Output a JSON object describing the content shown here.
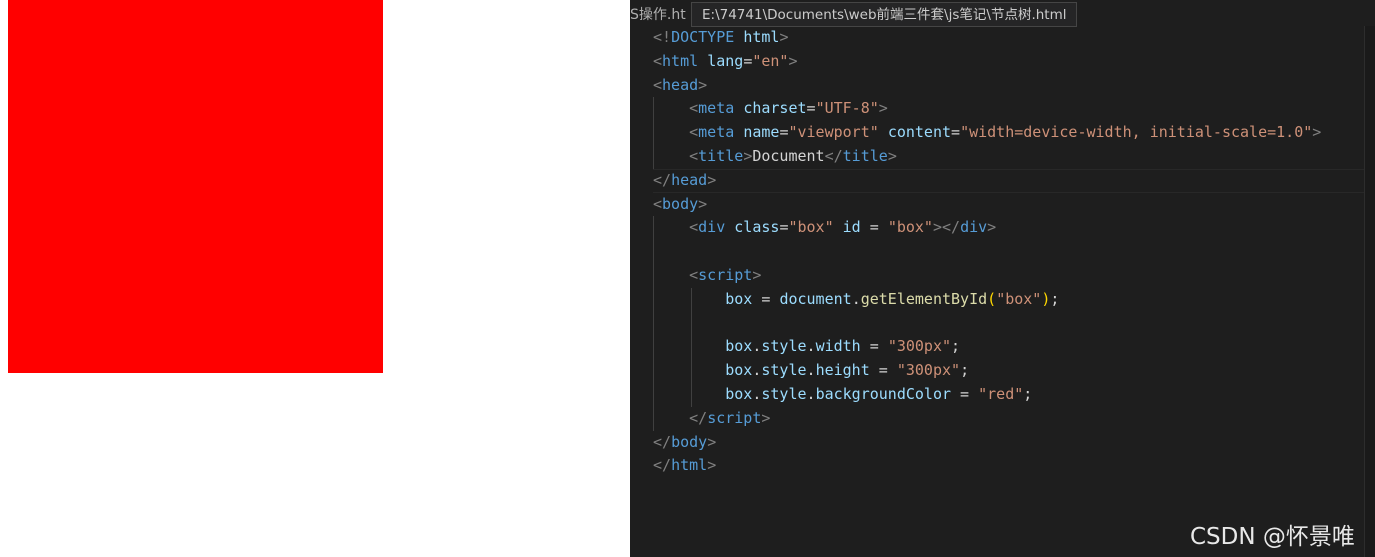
{
  "preview": {
    "box_color": "#ff0000"
  },
  "editor": {
    "tab_fragment": "S操作.ht",
    "tooltip_path": "E:\\74741\\Documents\\web前端三件套\\js笔记\\节点树.html",
    "lines": [
      [
        [
          "punc",
          "<!"
        ],
        [
          "tag",
          "DOCTYPE "
        ],
        [
          "attr",
          "html"
        ],
        [
          "punc",
          ">"
        ]
      ],
      [
        [
          "punc",
          "<"
        ],
        [
          "tag",
          "html "
        ],
        [
          "attr",
          "lang"
        ],
        [
          "txt",
          "="
        ],
        [
          "str",
          "\"en\""
        ],
        [
          "punc",
          ">"
        ]
      ],
      [
        [
          "punc",
          "<"
        ],
        [
          "tag",
          "head"
        ],
        [
          "punc",
          ">"
        ]
      ],
      [
        [
          "txt",
          "    "
        ],
        [
          "punc",
          "<"
        ],
        [
          "tag",
          "meta "
        ],
        [
          "attr",
          "charset"
        ],
        [
          "txt",
          "="
        ],
        [
          "str",
          "\"UTF-8\""
        ],
        [
          "punc",
          ">"
        ]
      ],
      [
        [
          "txt",
          "    "
        ],
        [
          "punc",
          "<"
        ],
        [
          "tag",
          "meta "
        ],
        [
          "attr",
          "name"
        ],
        [
          "txt",
          "="
        ],
        [
          "str",
          "\"viewport\""
        ],
        [
          "txt",
          " "
        ],
        [
          "attr",
          "content"
        ],
        [
          "txt",
          "="
        ],
        [
          "str",
          "\"width=device-width, initial-scale=1.0\""
        ],
        [
          "punc",
          ">"
        ]
      ],
      [
        [
          "txt",
          "    "
        ],
        [
          "punc",
          "<"
        ],
        [
          "tag",
          "title"
        ],
        [
          "punc",
          ">"
        ],
        [
          "txt",
          "Document"
        ],
        [
          "punc",
          "</"
        ],
        [
          "tag",
          "title"
        ],
        [
          "punc",
          ">"
        ]
      ],
      [
        [
          "punc",
          "</"
        ],
        [
          "tag",
          "head"
        ],
        [
          "punc",
          ">"
        ]
      ],
      [
        [
          "punc",
          "<"
        ],
        [
          "tag",
          "body"
        ],
        [
          "punc",
          ">"
        ]
      ],
      [
        [
          "txt",
          "    "
        ],
        [
          "punc",
          "<"
        ],
        [
          "tag",
          "div "
        ],
        [
          "attr",
          "class"
        ],
        [
          "txt",
          "="
        ],
        [
          "str",
          "\"box\""
        ],
        [
          "txt",
          " "
        ],
        [
          "attr",
          "id"
        ],
        [
          "txt",
          " = "
        ],
        [
          "str",
          "\"box\""
        ],
        [
          "punc",
          "></"
        ],
        [
          "tag",
          "div"
        ],
        [
          "punc",
          ">"
        ]
      ],
      [],
      [
        [
          "txt",
          "    "
        ],
        [
          "punc",
          "<"
        ],
        [
          "tag",
          "script"
        ],
        [
          "punc",
          ">"
        ]
      ],
      [
        [
          "txt",
          "        "
        ],
        [
          "var",
          "box"
        ],
        [
          "txt",
          " = "
        ],
        [
          "var",
          "document"
        ],
        [
          "txt",
          "."
        ],
        [
          "fn",
          "getElementById"
        ],
        [
          "br",
          "("
        ],
        [
          "str",
          "\"box\""
        ],
        [
          "br",
          ")"
        ],
        [
          "txt",
          ";"
        ]
      ],
      [],
      [
        [
          "txt",
          "        "
        ],
        [
          "var",
          "box"
        ],
        [
          "txt",
          "."
        ],
        [
          "var",
          "style"
        ],
        [
          "txt",
          "."
        ],
        [
          "var",
          "width"
        ],
        [
          "txt",
          " = "
        ],
        [
          "str",
          "\"300px\""
        ],
        [
          "txt",
          ";"
        ]
      ],
      [
        [
          "txt",
          "        "
        ],
        [
          "var",
          "box"
        ],
        [
          "txt",
          "."
        ],
        [
          "var",
          "style"
        ],
        [
          "txt",
          "."
        ],
        [
          "var",
          "height"
        ],
        [
          "txt",
          " = "
        ],
        [
          "str",
          "\"300px\""
        ],
        [
          "txt",
          ";"
        ]
      ],
      [
        [
          "txt",
          "        "
        ],
        [
          "var",
          "box"
        ],
        [
          "txt",
          "."
        ],
        [
          "var",
          "style"
        ],
        [
          "txt",
          "."
        ],
        [
          "var",
          "backgroundColor"
        ],
        [
          "txt",
          " = "
        ],
        [
          "str",
          "\"red\""
        ],
        [
          "txt",
          ";"
        ]
      ],
      [
        [
          "txt",
          "    "
        ],
        [
          "punc",
          "</"
        ],
        [
          "tag",
          "script"
        ],
        [
          "punc",
          ">"
        ]
      ],
      [
        [
          "punc",
          "</"
        ],
        [
          "tag",
          "body"
        ],
        [
          "punc",
          ">"
        ]
      ],
      [
        [
          "punc",
          "</"
        ],
        [
          "tag",
          "html"
        ],
        [
          "punc",
          ">"
        ]
      ]
    ]
  },
  "watermark": "CSDN @怀景唯"
}
